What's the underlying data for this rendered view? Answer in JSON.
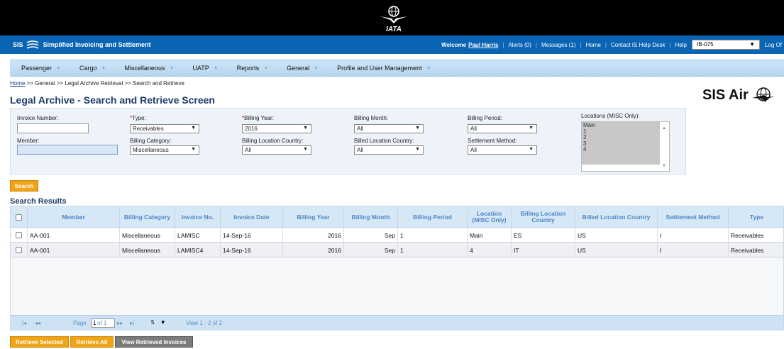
{
  "header": {
    "iata_logo_text": "IATA",
    "brand_prefix": "SIS",
    "brand_title": "Simplified Invoicing and Settlement",
    "welcome_label": "Welcome",
    "user_name": "Paul Harris",
    "alerts": "Alerts (0)",
    "messages": "Messages (1)",
    "home": "Home",
    "contact": "Contact IS Help Desk",
    "help": "Help",
    "member_code": "IB-075",
    "logoff": "Log Of"
  },
  "nav": {
    "items": [
      "Passenger",
      "Cargo",
      "Miscellaneous",
      "UATP",
      "Reports",
      "General",
      "Profile and User Management"
    ]
  },
  "breadcrumb": {
    "home": "Home",
    "rest": ">> General >> Legal Archive Retrieval >> Search and Retrieve"
  },
  "page_title": "Legal Archive - Search and Retrieve Screen",
  "brand_logo": "SIS Air",
  "filters": {
    "invoice_number_label": "Invoice Number:",
    "member_label": "Member:",
    "type_label": "Type:",
    "type_value": "Receivables",
    "billing_category_label": "Billing Category:",
    "billing_category_value": "Miscellaneous",
    "billing_year_label": "Billing Year:",
    "billing_year_value": "2016",
    "billing_location_country_label": "Billing Location Country:",
    "billing_location_country_value": "All",
    "billing_month_label": "Billing Month:",
    "billing_month_value": "All",
    "billed_location_country_label": "Billed Location Country:",
    "billed_location_country_value": "All",
    "billing_period_label": "Billing Period:",
    "billing_period_value": "All",
    "settlement_method_label": "Settlement Method:",
    "settlement_method_value": "All",
    "locations_label": "Locations (MISC Only):",
    "locations_options": [
      "Main",
      "1",
      "2",
      "3",
      "4"
    ],
    "required_mark": "*"
  },
  "search_button": "Search",
  "results": {
    "title": "Search Results",
    "columns": [
      "Member",
      "Billing Category",
      "Invoice No.",
      "Invoice Date",
      "Billing Year",
      "Billing Month",
      "Billing Period",
      "Location (MISC Only)",
      "Billing Location Country",
      "Billed Location Country",
      "Settlement Method",
      "Type"
    ],
    "rows": [
      [
        "AA-001",
        "Miscellaneous",
        "LAMISC",
        "14-Sep-16",
        "2016",
        "Sep",
        "1",
        "Main",
        "ES",
        "US",
        "I",
        "Receivables"
      ],
      [
        "AA-001",
        "Miscellaneous",
        "LAMISC4",
        "14-Sep-16",
        "2016",
        "Sep",
        "1",
        "4",
        "IT",
        "US",
        "I",
        "Receivables"
      ]
    ]
  },
  "pager": {
    "page_label": "Page",
    "page_value": "1",
    "of_label": "of 1",
    "page_size": "5",
    "view_text": "View 1 - 2 of 2"
  },
  "actions": {
    "retrieve_selected": "Retrieve Selected",
    "retrieve_all": "Retrieve All",
    "view_retrieved": "View Retrieved Invoices"
  }
}
